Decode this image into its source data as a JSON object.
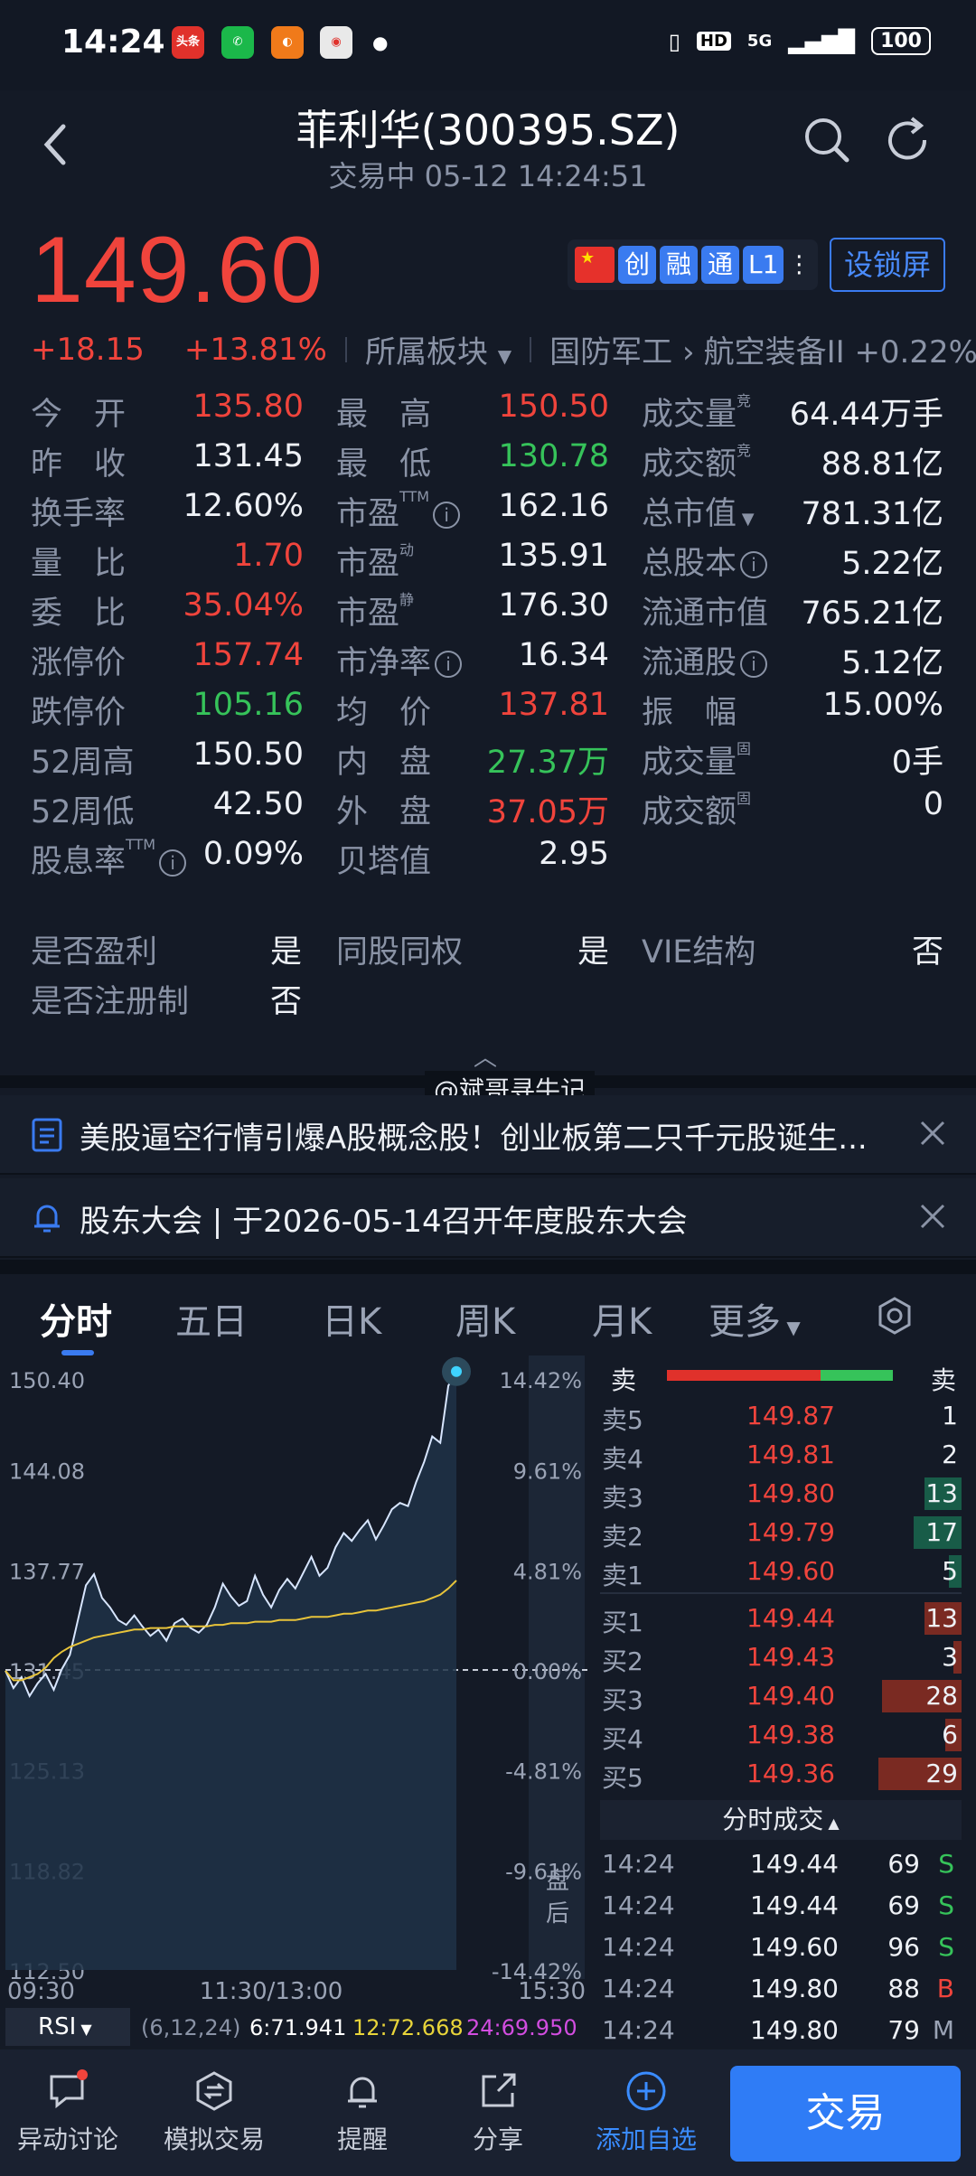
{
  "status": {
    "time": "14:24",
    "network": "5G",
    "battery": "100",
    "hd": "HD"
  },
  "header": {
    "title": "菲利华(300395.SZ)",
    "subtitle": "交易中 05-12 14:24:51"
  },
  "price": {
    "last": "149.60",
    "change": "+18.15",
    "change_pct": "+13.81%",
    "sector_label": "所属板块",
    "sector1": "国防军工",
    "sector2": "航空装备II +0.22%"
  },
  "tags": [
    "创",
    "融",
    "通",
    "L1"
  ],
  "lock_label": "设锁屏",
  "stats": [
    {
      "label": "今　开",
      "value": "135.80",
      "color": "red"
    },
    {
      "label": "最　高",
      "value": "150.50",
      "color": "red"
    },
    {
      "label": "成交量",
      "value": "64.44万手",
      "color": "white",
      "sup": "竞"
    },
    {
      "label": "昨　收",
      "value": "131.45",
      "color": "white"
    },
    {
      "label": "最　低",
      "value": "130.78",
      "color": "green"
    },
    {
      "label": "成交额",
      "value": "88.81亿",
      "color": "white",
      "sup": "竞"
    },
    {
      "label": "换手率",
      "value": "12.60%",
      "color": "white"
    },
    {
      "label": "市盈",
      "value": "162.16",
      "color": "white",
      "sup": "TTM",
      "info": true
    },
    {
      "label": "总市值",
      "value": "781.31亿",
      "color": "white",
      "caret": true
    },
    {
      "label": "量　比",
      "value": "1.70",
      "color": "red"
    },
    {
      "label": "市盈",
      "value": "135.91",
      "color": "white",
      "sup": "动"
    },
    {
      "label": "总股本",
      "value": "5.22亿",
      "color": "white",
      "info": true
    },
    {
      "label": "委　比",
      "value": "35.04%",
      "color": "red"
    },
    {
      "label": "市盈",
      "value": "176.30",
      "color": "white",
      "sup": "静"
    },
    {
      "label": "流通市值",
      "value": "765.21亿",
      "color": "white"
    },
    {
      "label": "涨停价",
      "value": "157.74",
      "color": "red"
    },
    {
      "label": "市净率",
      "value": "16.34",
      "color": "white",
      "info": true
    },
    {
      "label": "流通股",
      "value": "5.12亿",
      "color": "white",
      "info": true
    },
    {
      "label": "跌停价",
      "value": "105.16",
      "color": "green"
    },
    {
      "label": "均　价",
      "value": "137.81",
      "color": "red"
    },
    {
      "label": "振　幅",
      "value": "15.00%",
      "color": "white"
    },
    {
      "label": "52周高",
      "value": "150.50",
      "color": "white"
    },
    {
      "label": "内　盘",
      "value": "27.37万",
      "color": "green"
    },
    {
      "label": "成交量",
      "value": "0手",
      "color": "white",
      "sup": "固"
    },
    {
      "label": "52周低",
      "value": "42.50",
      "color": "white"
    },
    {
      "label": "外　盘",
      "value": "37.05万",
      "color": "red"
    },
    {
      "label": "成交额",
      "value": "0",
      "color": "white",
      "sup": "固"
    },
    {
      "label": "股息率",
      "value": "0.09%",
      "color": "white",
      "sup": "TTM",
      "info": true
    },
    {
      "label": "贝塔值",
      "value": "2.95",
      "color": "white"
    }
  ],
  "flags": [
    {
      "label": "是否盈利",
      "value": "是"
    },
    {
      "label": "同股同权",
      "value": "是"
    },
    {
      "label": "VIE结构",
      "value": "否"
    },
    {
      "label": "是否注册制",
      "value": "否"
    }
  ],
  "watermark": "@斌哥寻牛记",
  "news": [
    {
      "text": "美股逼空行情引爆A股概念股！创业板第二只千元股诞生...",
      "icon": "document-icon"
    },
    {
      "text": "股东大会 | 于2026-05-14召开年度股东大会",
      "icon": "bell-icon"
    }
  ],
  "tabs": [
    "分时",
    "五日",
    "日K",
    "周K",
    "月K",
    "更多"
  ],
  "chart_data": {
    "type": "line",
    "y_labels": [
      "150.40",
      "144.08",
      "137.77",
      "131.45",
      "125.13",
      "118.82",
      "112.50"
    ],
    "pct_labels": [
      "14.42%",
      "9.61%",
      "4.81%",
      "0.00%",
      "-4.81%",
      "-9.61%",
      "-14.42%"
    ],
    "x_labels": [
      "09:30",
      "11:30/13:00",
      "15:30"
    ],
    "ylim": [
      112.5,
      150.4
    ],
    "prev_close": 131.45,
    "after_hours_label": "盘后",
    "price_series": [
      131.4,
      130.3,
      131.0,
      129.8,
      130.6,
      131.2,
      130.2,
      131.5,
      132.4,
      134.6,
      136.8,
      137.5,
      136.0,
      135.4,
      134.6,
      134.3,
      134.9,
      134.2,
      133.6,
      134.0,
      133.3,
      134.4,
      134.7,
      134.1,
      133.8,
      134.3,
      135.4,
      136.9,
      136.1,
      135.5,
      135.8,
      137.4,
      136.2,
      135.4,
      136.5,
      137.2,
      136.6,
      137.6,
      138.6,
      137.4,
      137.9,
      139.2,
      140.1,
      139.6,
      140.3,
      140.9,
      139.7,
      140.6,
      141.6,
      142.0,
      141.8,
      143.3,
      144.6,
      146.2,
      145.8,
      149.4,
      150.3
    ],
    "avg_series": [
      131.4,
      130.8,
      130.8,
      131.0,
      131.2,
      131.6,
      132.2,
      132.6,
      132.9,
      133.1,
      133.3,
      133.5,
      133.6,
      133.7,
      133.8,
      133.9,
      134.0,
      134.0,
      134.1,
      134.1,
      134.1,
      134.2,
      134.2,
      134.2,
      134.2,
      134.2,
      134.3,
      134.3,
      134.4,
      134.4,
      134.4,
      134.5,
      134.5,
      134.5,
      134.6,
      134.6,
      134.6,
      134.7,
      134.8,
      134.8,
      134.8,
      134.9,
      135.0,
      135.0,
      135.1,
      135.2,
      135.2,
      135.3,
      135.4,
      135.5,
      135.6,
      135.7,
      135.8,
      136.0,
      136.2,
      136.6,
      137.1
    ],
    "indicator": {
      "name": "RSI",
      "params": "(6,12,24)",
      "values": [
        "6:71.941",
        "12:72.668",
        "24:69.950"
      ]
    }
  },
  "order_book": {
    "header_sell": "卖",
    "header_sell2": "卖",
    "asks": [
      {
        "label": "卖5",
        "price": "149.87",
        "qty": "1",
        "bar": 0.0
      },
      {
        "label": "卖4",
        "price": "149.81",
        "qty": "2",
        "bar": 0.0
      },
      {
        "label": "卖3",
        "price": "149.80",
        "qty": "13",
        "bar": 0.45
      },
      {
        "label": "卖2",
        "price": "149.79",
        "qty": "17",
        "bar": 0.58
      },
      {
        "label": "卖1",
        "price": "149.60",
        "qty": "5",
        "bar": 0.15
      }
    ],
    "bids": [
      {
        "label": "买1",
        "price": "149.44",
        "qty": "13",
        "bar": 0.45
      },
      {
        "label": "买2",
        "price": "149.43",
        "qty": "3",
        "bar": 0.1
      },
      {
        "label": "买3",
        "price": "149.40",
        "qty": "28",
        "bar": 0.96
      },
      {
        "label": "买4",
        "price": "149.38",
        "qty": "6",
        "bar": 0.2
      },
      {
        "label": "买5",
        "price": "149.36",
        "qty": "29",
        "bar": 1.0
      }
    ],
    "trades_title": "分时成交",
    "trades": [
      {
        "time": "14:24",
        "price": "149.44",
        "vol": "69",
        "flag": "S"
      },
      {
        "time": "14:24",
        "price": "149.44",
        "vol": "69",
        "flag": "S"
      },
      {
        "time": "14:24",
        "price": "149.60",
        "vol": "96",
        "flag": "S"
      },
      {
        "time": "14:24",
        "price": "149.80",
        "vol": "88",
        "flag": "B"
      },
      {
        "time": "14:24",
        "price": "149.80",
        "vol": "79",
        "flag": "M"
      }
    ]
  },
  "bottom_nav": [
    "异动讨论",
    "模拟交易",
    "提醒",
    "分享",
    "添加自选"
  ],
  "trade_label": "交易",
  "colors": {
    "up": "#f0443c",
    "down": "#36c35a",
    "accent": "#3a7bf0",
    "bg": "#141a26"
  }
}
